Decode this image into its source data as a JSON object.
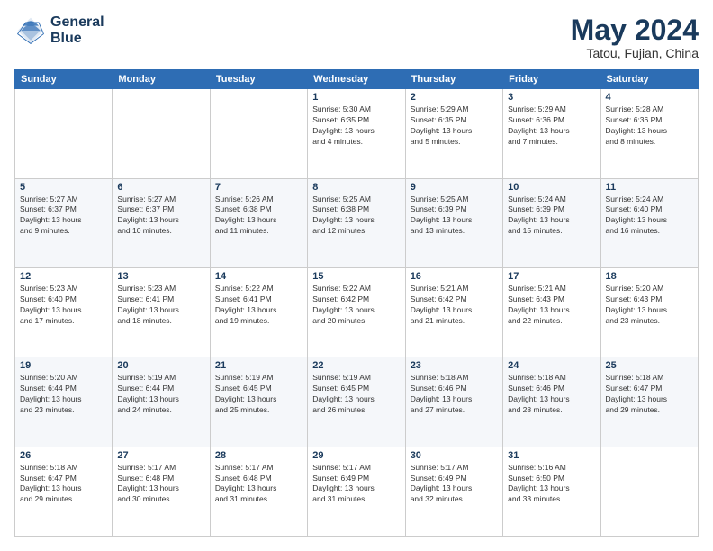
{
  "logo": {
    "line1": "General",
    "line2": "Blue"
  },
  "title": {
    "month_year": "May 2024",
    "location": "Tatou, Fujian, China"
  },
  "weekdays": [
    "Sunday",
    "Monday",
    "Tuesday",
    "Wednesday",
    "Thursday",
    "Friday",
    "Saturday"
  ],
  "weeks": [
    [
      {
        "day": "",
        "info": ""
      },
      {
        "day": "",
        "info": ""
      },
      {
        "day": "",
        "info": ""
      },
      {
        "day": "1",
        "info": "Sunrise: 5:30 AM\nSunset: 6:35 PM\nDaylight: 13 hours\nand 4 minutes."
      },
      {
        "day": "2",
        "info": "Sunrise: 5:29 AM\nSunset: 6:35 PM\nDaylight: 13 hours\nand 5 minutes."
      },
      {
        "day": "3",
        "info": "Sunrise: 5:29 AM\nSunset: 6:36 PM\nDaylight: 13 hours\nand 7 minutes."
      },
      {
        "day": "4",
        "info": "Sunrise: 5:28 AM\nSunset: 6:36 PM\nDaylight: 13 hours\nand 8 minutes."
      }
    ],
    [
      {
        "day": "5",
        "info": "Sunrise: 5:27 AM\nSunset: 6:37 PM\nDaylight: 13 hours\nand 9 minutes."
      },
      {
        "day": "6",
        "info": "Sunrise: 5:27 AM\nSunset: 6:37 PM\nDaylight: 13 hours\nand 10 minutes."
      },
      {
        "day": "7",
        "info": "Sunrise: 5:26 AM\nSunset: 6:38 PM\nDaylight: 13 hours\nand 11 minutes."
      },
      {
        "day": "8",
        "info": "Sunrise: 5:25 AM\nSunset: 6:38 PM\nDaylight: 13 hours\nand 12 minutes."
      },
      {
        "day": "9",
        "info": "Sunrise: 5:25 AM\nSunset: 6:39 PM\nDaylight: 13 hours\nand 13 minutes."
      },
      {
        "day": "10",
        "info": "Sunrise: 5:24 AM\nSunset: 6:39 PM\nDaylight: 13 hours\nand 15 minutes."
      },
      {
        "day": "11",
        "info": "Sunrise: 5:24 AM\nSunset: 6:40 PM\nDaylight: 13 hours\nand 16 minutes."
      }
    ],
    [
      {
        "day": "12",
        "info": "Sunrise: 5:23 AM\nSunset: 6:40 PM\nDaylight: 13 hours\nand 17 minutes."
      },
      {
        "day": "13",
        "info": "Sunrise: 5:23 AM\nSunset: 6:41 PM\nDaylight: 13 hours\nand 18 minutes."
      },
      {
        "day": "14",
        "info": "Sunrise: 5:22 AM\nSunset: 6:41 PM\nDaylight: 13 hours\nand 19 minutes."
      },
      {
        "day": "15",
        "info": "Sunrise: 5:22 AM\nSunset: 6:42 PM\nDaylight: 13 hours\nand 20 minutes."
      },
      {
        "day": "16",
        "info": "Sunrise: 5:21 AM\nSunset: 6:42 PM\nDaylight: 13 hours\nand 21 minutes."
      },
      {
        "day": "17",
        "info": "Sunrise: 5:21 AM\nSunset: 6:43 PM\nDaylight: 13 hours\nand 22 minutes."
      },
      {
        "day": "18",
        "info": "Sunrise: 5:20 AM\nSunset: 6:43 PM\nDaylight: 13 hours\nand 23 minutes."
      }
    ],
    [
      {
        "day": "19",
        "info": "Sunrise: 5:20 AM\nSunset: 6:44 PM\nDaylight: 13 hours\nand 23 minutes."
      },
      {
        "day": "20",
        "info": "Sunrise: 5:19 AM\nSunset: 6:44 PM\nDaylight: 13 hours\nand 24 minutes."
      },
      {
        "day": "21",
        "info": "Sunrise: 5:19 AM\nSunset: 6:45 PM\nDaylight: 13 hours\nand 25 minutes."
      },
      {
        "day": "22",
        "info": "Sunrise: 5:19 AM\nSunset: 6:45 PM\nDaylight: 13 hours\nand 26 minutes."
      },
      {
        "day": "23",
        "info": "Sunrise: 5:18 AM\nSunset: 6:46 PM\nDaylight: 13 hours\nand 27 minutes."
      },
      {
        "day": "24",
        "info": "Sunrise: 5:18 AM\nSunset: 6:46 PM\nDaylight: 13 hours\nand 28 minutes."
      },
      {
        "day": "25",
        "info": "Sunrise: 5:18 AM\nSunset: 6:47 PM\nDaylight: 13 hours\nand 29 minutes."
      }
    ],
    [
      {
        "day": "26",
        "info": "Sunrise: 5:18 AM\nSunset: 6:47 PM\nDaylight: 13 hours\nand 29 minutes."
      },
      {
        "day": "27",
        "info": "Sunrise: 5:17 AM\nSunset: 6:48 PM\nDaylight: 13 hours\nand 30 minutes."
      },
      {
        "day": "28",
        "info": "Sunrise: 5:17 AM\nSunset: 6:48 PM\nDaylight: 13 hours\nand 31 minutes."
      },
      {
        "day": "29",
        "info": "Sunrise: 5:17 AM\nSunset: 6:49 PM\nDaylight: 13 hours\nand 31 minutes."
      },
      {
        "day": "30",
        "info": "Sunrise: 5:17 AM\nSunset: 6:49 PM\nDaylight: 13 hours\nand 32 minutes."
      },
      {
        "day": "31",
        "info": "Sunrise: 5:16 AM\nSunset: 6:50 PM\nDaylight: 13 hours\nand 33 minutes."
      },
      {
        "day": "",
        "info": ""
      }
    ]
  ]
}
